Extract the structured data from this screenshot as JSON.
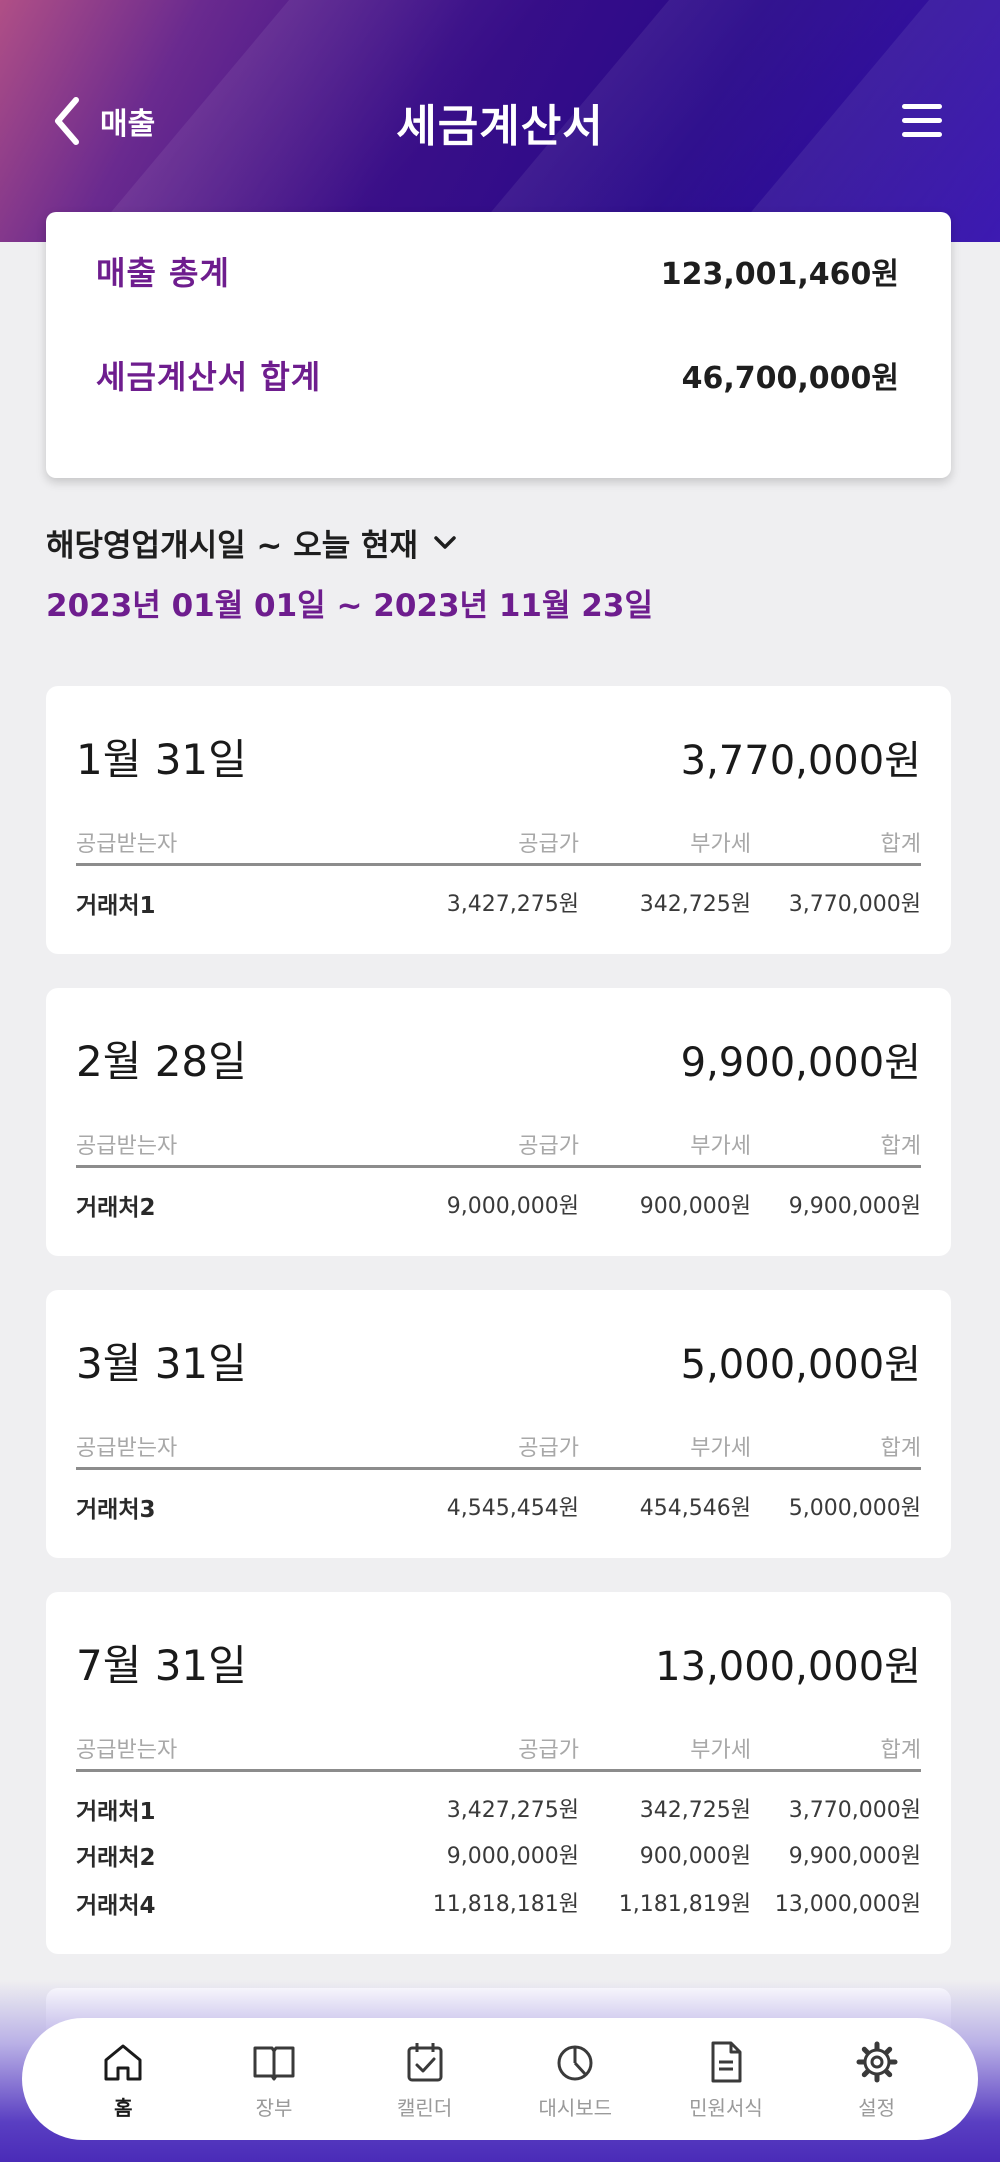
{
  "header": {
    "back_label": "매출",
    "title": "세금계산서"
  },
  "summary": {
    "sales_label": "매출 총계",
    "sales_value": "123,001,460원",
    "invoice_label": "세금계산서 합계",
    "invoice_value": "46,700,000원"
  },
  "period": {
    "selector_label": "해당영업개시일 ~ 오늘 현재",
    "range": "2023년 01월 01일 ~ 2023년 11월 23일"
  },
  "columns": {
    "name": "공급받는자",
    "supply": "공급가",
    "vat": "부가세",
    "sum": "합계"
  },
  "cards": [
    {
      "date": "1월 31일",
      "total": "3,770,000원",
      "rows": [
        {
          "name": "거래처1",
          "supply": "3,427,275원",
          "vat": "342,725원",
          "sum": "3,770,000원"
        }
      ]
    },
    {
      "date": "2월 28일",
      "total": "9,900,000원",
      "rows": [
        {
          "name": "거래처2",
          "supply": "9,000,000원",
          "vat": "900,000원",
          "sum": "9,900,000원"
        }
      ]
    },
    {
      "date": "3월 31일",
      "total": "5,000,000원",
      "rows": [
        {
          "name": "거래처3",
          "supply": "4,545,454원",
          "vat": "454,546원",
          "sum": "5,000,000원"
        }
      ]
    },
    {
      "date": "7월 31일",
      "total": "13,000,000원",
      "rows": [
        {
          "name": "거래처1",
          "supply": "3,427,275원",
          "vat": "342,725원",
          "sum": "3,770,000원"
        },
        {
          "name": "거래처2",
          "supply": "9,000,000원",
          "vat": "900,000원",
          "sum": "9,900,000원"
        },
        {
          "name": "거래처4",
          "supply": "11,818,181원",
          "vat": "1,181,819원",
          "sum": "13,000,000원"
        }
      ]
    }
  ],
  "tabbar": {
    "items": [
      {
        "label": "홈",
        "icon": "home-icon",
        "active": true
      },
      {
        "label": "장부",
        "icon": "book-icon",
        "active": false
      },
      {
        "label": "캘린더",
        "icon": "calendar-icon",
        "active": false
      },
      {
        "label": "대시보드",
        "icon": "chart-pie-icon",
        "active": false
      },
      {
        "label": "민원서식",
        "icon": "document-icon",
        "active": false
      },
      {
        "label": "설정",
        "icon": "gear-icon",
        "active": false
      }
    ]
  },
  "colors": {
    "accent": "#6e1d8e",
    "header_dark": "#29098a",
    "header_pink": "#b04f86",
    "background": "#efeff1"
  }
}
